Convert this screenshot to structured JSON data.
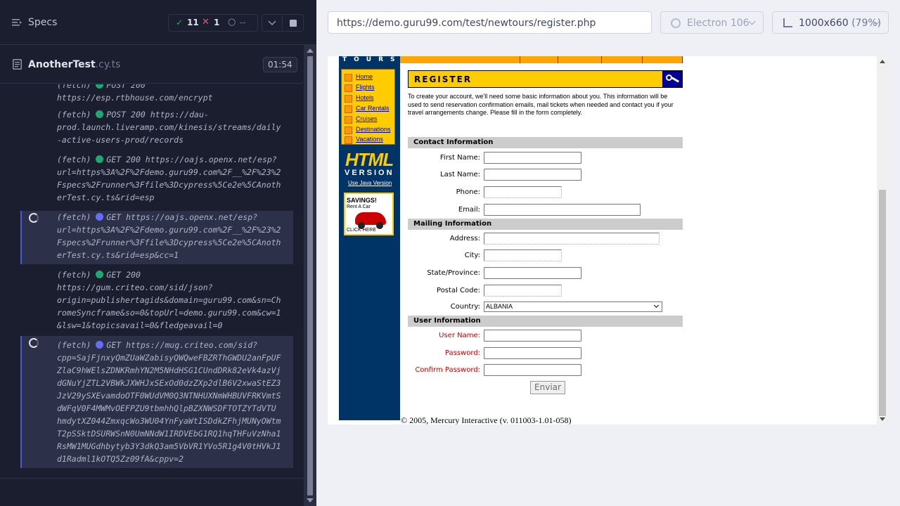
{
  "runner": {
    "specs_label": "Specs",
    "stats": {
      "passed": "11",
      "failed": "1",
      "pending": "--"
    },
    "file": {
      "name": "AnotherTest",
      "ext": ".cy.ts",
      "time": "01:54"
    },
    "commands": [
      {
        "prefix": "(fetch)",
        "status": "done",
        "text": "POST 200\nhttps://esp.rtbhouse.com/encrypt",
        "first_line_cut": true
      },
      {
        "prefix": "(fetch)",
        "status": "done",
        "text": "POST 200 https://dau-\nprod.launch.liveramp.com/kinesis/streams/daily\n-active-users-prod/records"
      },
      {
        "prefix": "(fetch)",
        "status": "done",
        "text": "GET 200 https://oajs.openx.net/esp?\nurl=https%3A%2F%2Fdemo.guru99.com%2F__%2F%23%2\nFspecs%2Frunner%3Ffile%3Dcypress%5Ce2e%5CAnoth\nerTest.cy.ts&rid=esp"
      },
      {
        "prefix": "(fetch)",
        "status": "pending",
        "text": "GET https://oajs.openx.net/esp?\nurl=https%3A%2F%2Fdemo.guru99.com%2F__%2F%23%2\nFspecs%2Frunner%3Ffile%3Dcypress%5Ce2e%5CAnoth\nerTest.cy.ts&rid=esp&cc=1"
      },
      {
        "prefix": "(fetch)",
        "status": "done",
        "text": "GET 200\nhttps://gum.criteo.com/sid/json?\norigin=publishertagids&domain=guru99.com&sn=Ch\nromeSyncframe&so=0&topUrl=demo.guru99.com&cw=1\n&lsw=1&topicsavail=0&fledgeavail=0"
      },
      {
        "prefix": "(fetch)",
        "status": "pending",
        "text": "GET https://mug.criteo.com/sid?\ncpp=SajFjnxyQmZUaWZabisyQWQweFBZRThGWDU2anFpUF\nZlaC9hWElsZDNKRmhYN2M5NHdHSG1CUndDRk82eVk4azVj\ndGNuYjZTL2VBWkJXWHJxSExOd0dzZXp2dlB6V2xwaStEZ3\nJzV29ySXEvamdoOTF0WUdVM0Q3NTNHUXNmWHBUVFRKVmtS\ndWFqV0F4MWMvOEFPZU9tbmhhQlpBZXNWSDFTOTZYTdVTU\nhmdytXZ044ZmxqcWo3WU04YnFyaWtISDdkZFhjMUNyOWtm\nT2pSSktDSURWSnN0UmNNdW1IRDVEbG1RQ1hqTHFuVzNha1\nRsMW1MUGdhbytyb3Y3dkQ3am5VbVR1YVo5R1g4V0tHVkJ1\nd1Radml1kOTQ5Zz09fA&cppv=2"
      }
    ]
  },
  "browser": {
    "url": "https://demo.guru99.com/test/newtours/register.php",
    "engine": "Electron 106",
    "viewport": "1000x660",
    "zoom": "(79%)"
  },
  "tours": {
    "brand": "TOURS",
    "nav": [
      "Home",
      "Flights",
      "Hotels",
      "Car Rentals",
      "Cruises",
      "Destinations",
      "Vacations"
    ],
    "html_big": "HTML",
    "version": "VERSION",
    "java_link": "Use Java Version",
    "ad": {
      "title": "SAVINGS!",
      "sub": "Rent A Car",
      "click": "CLICK HERE"
    },
    "register_title": "REGISTER",
    "intro": "To create your account, we'll need some basic information about you. This information will be used to send reservation confirmation emails, mail tickets when needed and contact you if your travel arrangements change. Please fill in the form completely.",
    "sections": {
      "contact": "Contact Information",
      "mailing": "Mailing Information",
      "user": "User Information"
    },
    "labels": {
      "first_name": "First Name:",
      "last_name": "Last Name:",
      "phone": "Phone:",
      "email": "Email:",
      "address": "Address:",
      "city": "City:",
      "state": "State/Province:",
      "postal": "Postal Code:",
      "country": "Country:",
      "username": "User Name:",
      "password": "Password:",
      "confirm": "Confirm Password:"
    },
    "country_value": "ALBANIA",
    "submit": "Enviar",
    "copyright": "© 2005, Mercury Interactive (v. 011003-1.01-058)"
  },
  "colors": {
    "pass": "#1fa971",
    "fail": "#e45770",
    "pending_dot": "#6470f3",
    "nav_bg": "#003366",
    "accent": "#ffcc00"
  }
}
